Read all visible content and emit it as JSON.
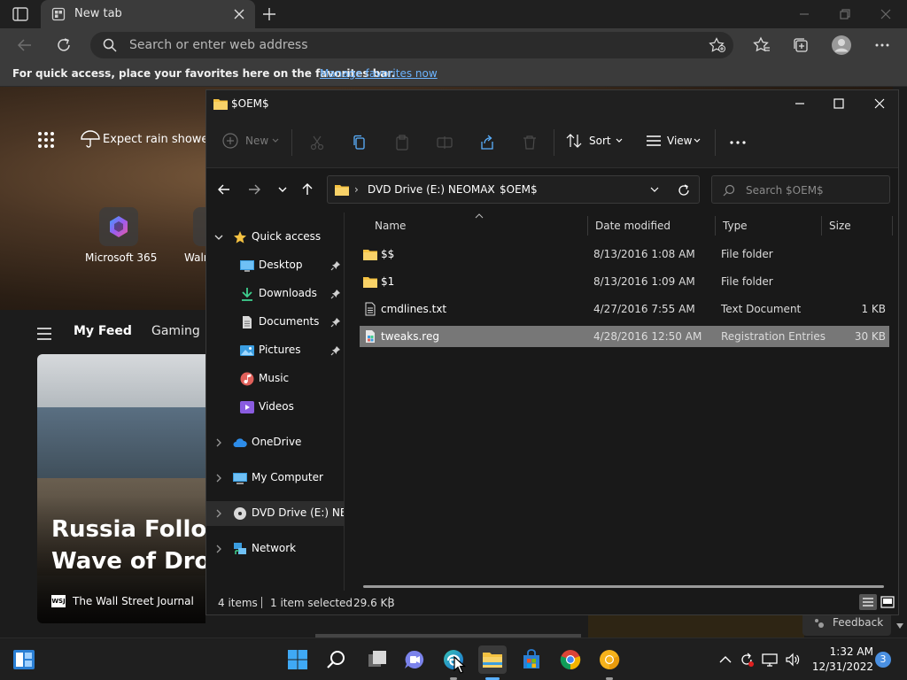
{
  "browser": {
    "tab_title": "New tab",
    "address_placeholder": "Search or enter web address",
    "favorites_prompt": "For quick access, place your favorites here on the favorites bar.",
    "favorites_link": "Manage favorites now"
  },
  "newtab": {
    "weather": "Expect rain showe...",
    "tile1_label": "Microsoft 365",
    "tile2_label": "Walr",
    "feed_tabs": [
      "My Feed",
      "Gaming"
    ],
    "headline": "Russia Follows\nWave of Dron",
    "source": "The Wall Street Journal",
    "source_logo": "WSJ",
    "feedback": "Feedback"
  },
  "explorer": {
    "title": "$OEM$",
    "commands": {
      "new": "New",
      "sort": "Sort",
      "view": "View"
    },
    "breadcrumb": [
      "DVD Drive (E:) NEOMAX",
      "$OEM$"
    ],
    "search_placeholder": "Search $OEM$",
    "tree": [
      {
        "label": "Quick access",
        "icon": "star-icon",
        "expandable": true,
        "expanded": true,
        "indent": 0
      },
      {
        "label": "Desktop",
        "icon": "desktop-icon",
        "pinned": true,
        "indent": 1
      },
      {
        "label": "Downloads",
        "icon": "download-icon",
        "pinned": true,
        "indent": 1
      },
      {
        "label": "Documents",
        "icon": "document-icon",
        "pinned": true,
        "indent": 1
      },
      {
        "label": "Pictures",
        "icon": "pictures-icon",
        "pinned": true,
        "indent": 1
      },
      {
        "label": "Music",
        "icon": "music-icon",
        "indent": 1
      },
      {
        "label": "Videos",
        "icon": "videos-icon",
        "indent": 1
      },
      {
        "label": "OneDrive",
        "icon": "onedrive-icon",
        "expandable": true,
        "indent": 0
      },
      {
        "label": "My Computer",
        "icon": "computer-icon",
        "expandable": true,
        "indent": 0
      },
      {
        "label": "DVD Drive (E:) NEOMAX",
        "icon": "dvd-icon",
        "expandable": true,
        "selected": true,
        "indent": 0
      },
      {
        "label": "Network",
        "icon": "network-icon",
        "expandable": true,
        "indent": 0
      }
    ],
    "columns": [
      "Name",
      "Date modified",
      "Type",
      "Size"
    ],
    "files": [
      {
        "name": "$$",
        "date": "8/13/2016 1:08 AM",
        "type": "File folder",
        "size": "",
        "icon": "folder-icon"
      },
      {
        "name": "$1",
        "date": "8/13/2016 1:09 AM",
        "type": "File folder",
        "size": "",
        "icon": "folder-icon"
      },
      {
        "name": "cmdlines.txt",
        "date": "4/27/2016 7:55 AM",
        "type": "Text Document",
        "size": "1 KB",
        "icon": "text-file-icon"
      },
      {
        "name": "tweaks.reg",
        "date": "4/28/2016 12:50 AM",
        "type": "Registration Entries",
        "size": "30 KB",
        "icon": "registry-file-icon",
        "selected": true
      }
    ],
    "status": {
      "count": "4 items",
      "selected": "1 item selected",
      "selected_size": "29.6 KB"
    }
  },
  "taskbar": {
    "time": "1:32 AM",
    "date": "12/31/2022",
    "notifications": "3"
  },
  "colors": {
    "accent": "#5ab0ff",
    "folder": "#f5c242",
    "selection": "#777777"
  }
}
